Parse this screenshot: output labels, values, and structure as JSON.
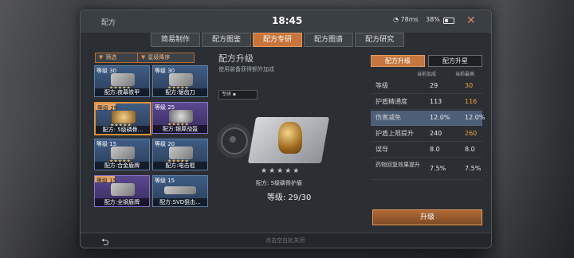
{
  "window": {
    "title": "配方",
    "time": "18:45",
    "wifi": "78ms",
    "battery": "38%"
  },
  "tabs": [
    {
      "label": "简易制作",
      "active": false
    },
    {
      "label": "配方图鉴",
      "active": false
    },
    {
      "label": "配方专研",
      "active": true
    },
    {
      "label": "配方图谱",
      "active": false
    },
    {
      "label": "配方研究",
      "active": false
    }
  ],
  "filters": {
    "filter_label": "筛选",
    "sort_label": "星级降序"
  },
  "recipes": [
    {
      "level": "等级 30",
      "name": "配方:夜幕铁甲",
      "quality": "blue"
    },
    {
      "level": "等级 30",
      "name": "配方:锯齿刀",
      "quality": "blue"
    },
    {
      "level": "等级 29",
      "name": "配方: 5级磷骨...",
      "quality": "blue",
      "selected": true
    },
    {
      "level": "等级 25",
      "name": "配方:银犀战盔",
      "quality": "purple"
    },
    {
      "level": "等级 15",
      "name": "配方:合金盾牌",
      "quality": "blue"
    },
    {
      "level": "等级 20",
      "name": "配方:电击棍",
      "quality": "blue"
    },
    {
      "level": "等级 15",
      "name": "配方:全钢盾牌",
      "quality": "purple"
    },
    {
      "level": "等级 15",
      "name": "配方:SVD狙击...",
      "quality": "blue"
    }
  ],
  "detail": {
    "title": "配方升级",
    "subtitle": "使用装备获得额外加成",
    "tag": "专研",
    "stars": "★★★★★",
    "name": "配方: 5级磷骨护盾",
    "level": "等级: 29/30"
  },
  "stats_panel": {
    "tab_upgrade": "配方升级",
    "tab_star": "配方升星",
    "col_current": "当前加成",
    "col_max": "当前最高",
    "rows": [
      {
        "label": "等级",
        "current": "29",
        "max": "30",
        "up": true
      },
      {
        "label": "护盾精通度",
        "current": "113",
        "max": "116",
        "up": true
      },
      {
        "label": "伤害减免",
        "current": "12.0%",
        "max": "12.0%",
        "highlight": true
      },
      {
        "label": "护盾上限提升",
        "current": "240",
        "max": "260",
        "up": true
      },
      {
        "label": "误导",
        "current": "8.0",
        "max": "8.0"
      },
      {
        "label": "药物回复效果提升",
        "current": "7.5%",
        "max": "7.5%"
      }
    ],
    "upgrade_button": "升级"
  },
  "footer": {
    "back_icon": "back-arrow-icon",
    "hint": "点击空白处关闭"
  }
}
